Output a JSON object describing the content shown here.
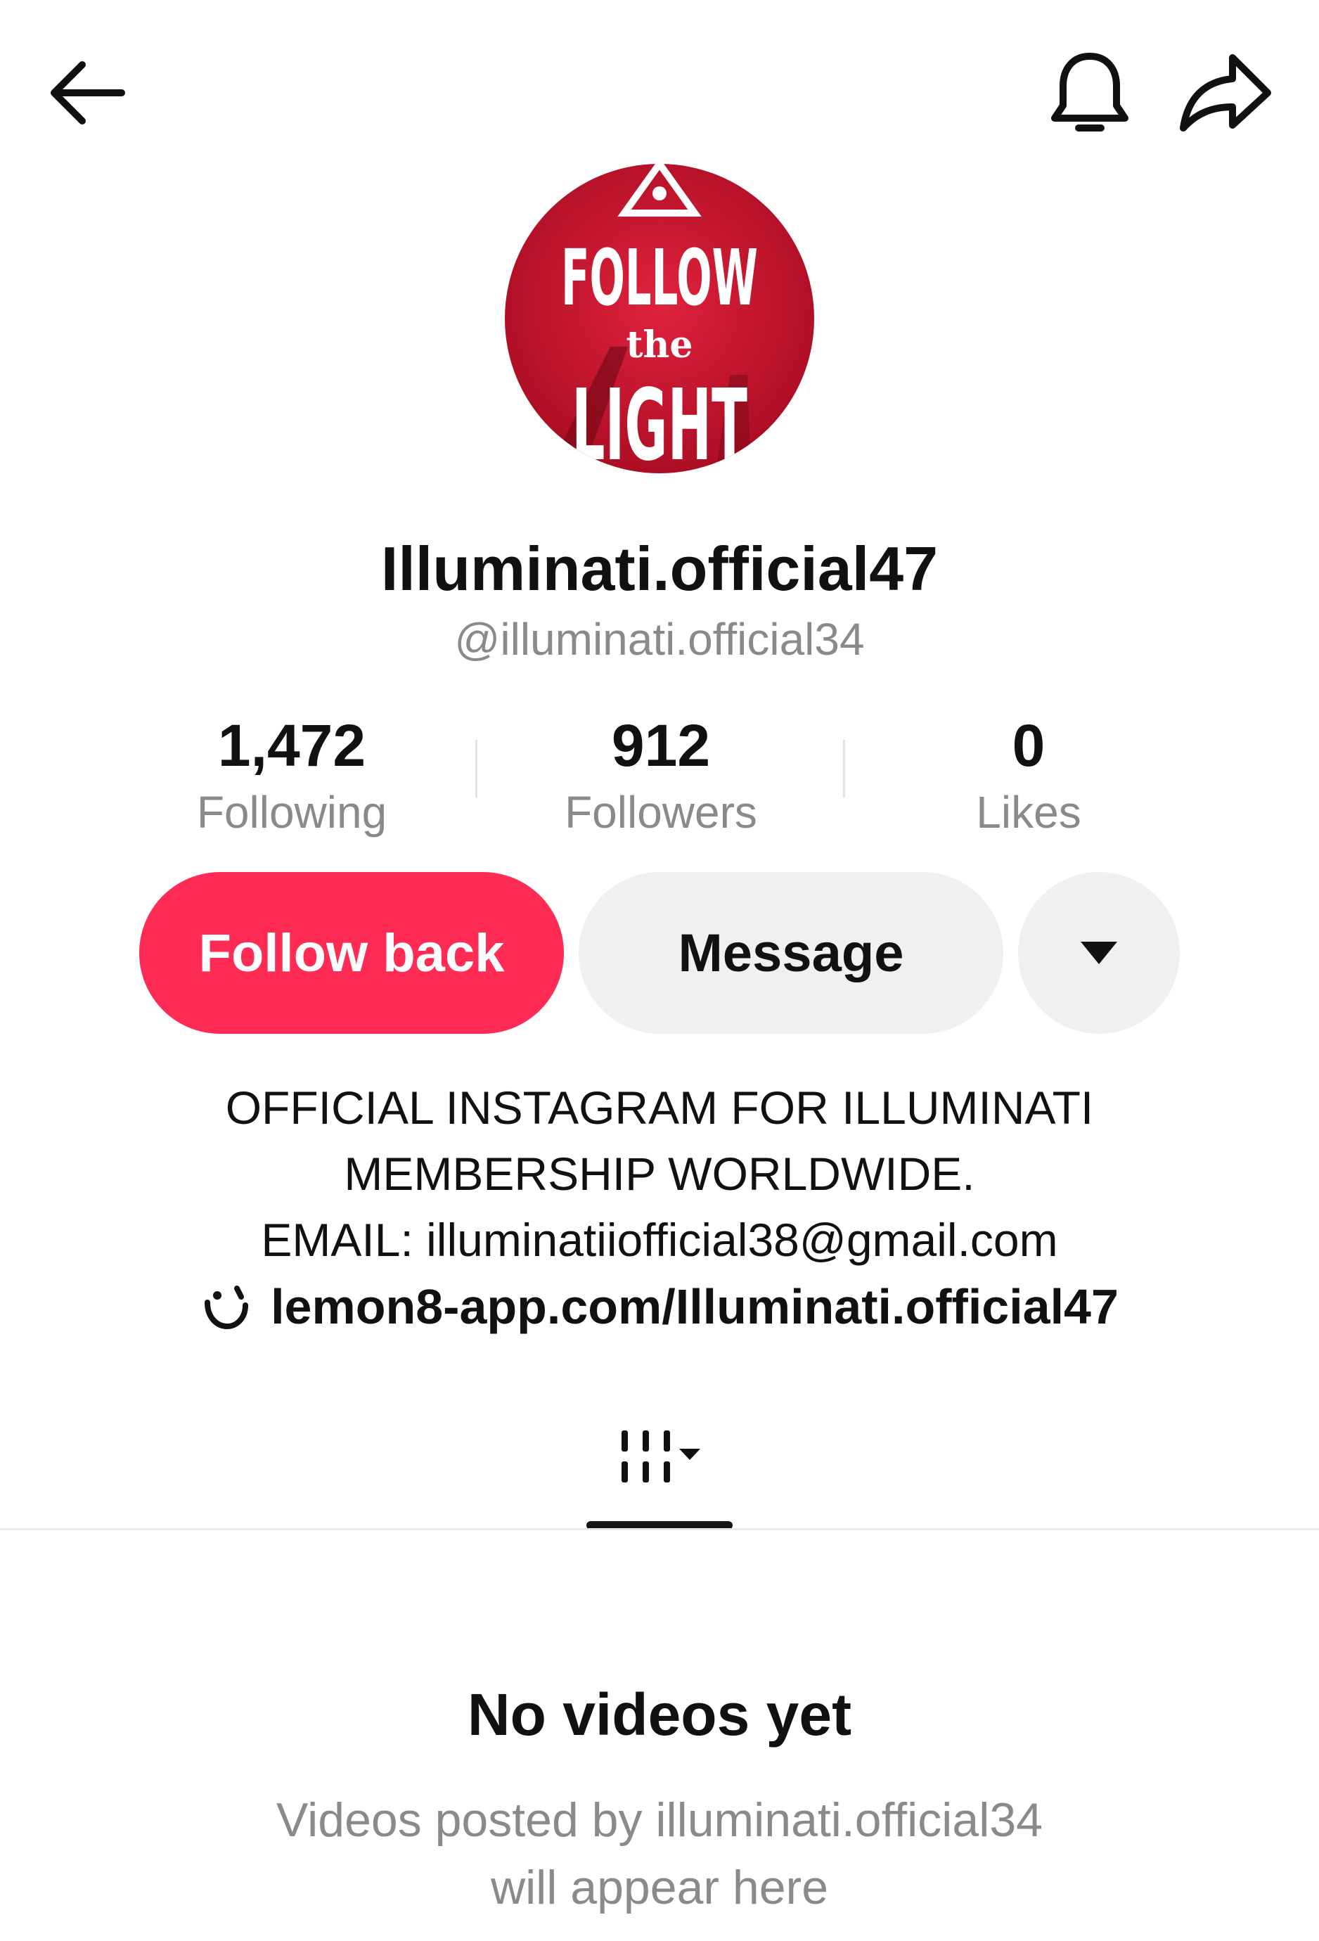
{
  "topbar": {
    "back_icon": "back-arrow-icon",
    "bell_icon": "bell-icon",
    "share_icon": "share-icon"
  },
  "profile": {
    "avatar_text": {
      "line1": "FOLLOW",
      "line2": "the",
      "line3": "LIGHT"
    },
    "display_name": "Illuminati.official47",
    "handle": "@illuminati.official34"
  },
  "stats": {
    "following": {
      "value": "1,472",
      "label": "Following"
    },
    "followers": {
      "value": "912",
      "label": "Followers"
    },
    "likes": {
      "value": "0",
      "label": "Likes"
    }
  },
  "actions": {
    "follow_back_label": "Follow back",
    "message_label": "Message",
    "more_icon": "caret-down-icon"
  },
  "bio": {
    "lines": [
      "OFFICIAL INSTAGRAM FOR ILLUMINATI",
      "MEMBERSHIP WORLDWIDE.",
      "EMAIL: illuminatiiofficial38@gmail.com"
    ],
    "link_icon": "lemon8-smile-icon",
    "link_text": "lemon8-app.com/Illuminati.official47"
  },
  "tabs": {
    "videos_icon": "video-grid-icon",
    "videos_dropdown_icon": "caret-down-icon"
  },
  "empty_state": {
    "title": "No videos yet",
    "description_line1": "Videos posted by illuminati.official34",
    "description_line2": "will appear here"
  },
  "colors": {
    "accent": "#fe2c55",
    "secondary_button": "#f0f0f0",
    "muted_text": "#8a8a8a",
    "avatar_red": "#c8102e"
  }
}
